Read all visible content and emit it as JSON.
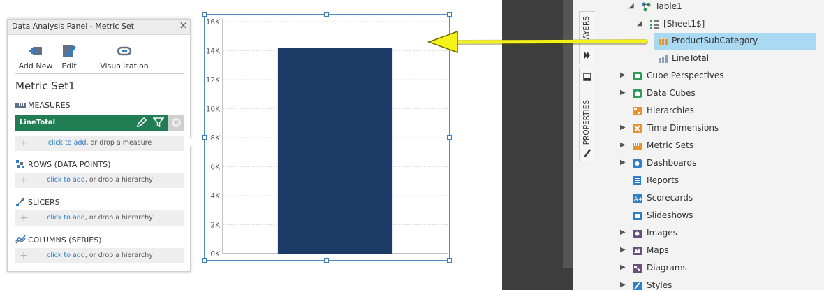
{
  "panel": {
    "title": "Data Analysis Panel - Metric Set",
    "toolbar": {
      "add_new": "Add New",
      "edit": "Edit",
      "visualization": "Visualization"
    },
    "metric_set_name": "Metric Set1",
    "sections": {
      "measures": "MEASURES",
      "rows": "ROWS (DATA POINTS)",
      "slicers": "SLICERS",
      "columns": "COLUMNS (SERIES)"
    },
    "measure_item": "LineTotal",
    "click_to_add": "click to add",
    "drop_measure": ", or drop a measure",
    "drop_hierarchy": ", or drop a hierarchy"
  },
  "chart_data": {
    "type": "bar",
    "categories": [
      ""
    ],
    "values": [
      14200
    ],
    "ylim": [
      0,
      16000
    ],
    "yticks": [
      "0K",
      "2K",
      "4K",
      "6K",
      "8K",
      "10K",
      "12K",
      "14K",
      "16K"
    ],
    "grid": true,
    "bar_color": "#1b3a66"
  },
  "side_tabs": {
    "layers": "LAYERS",
    "properties": "PROPERTIES"
  },
  "tree": {
    "table": "Table1",
    "sheet": "[Sheet1$]",
    "fields": [
      "ProductSubCategory",
      "LineTotal"
    ],
    "items": [
      "Cube Perspectives",
      "Data Cubes",
      "Hierarchies",
      "Time Dimensions",
      "Metric Sets",
      "Dashboards",
      "Reports",
      "Scorecards",
      "Slideshows",
      "Images",
      "Maps",
      "Diagrams",
      "Styles"
    ]
  },
  "colors": {
    "accent_green": "#217d53",
    "selection": "#aad9f4",
    "arrow": "#f5f21a",
    "link": "#2a7bc4"
  }
}
